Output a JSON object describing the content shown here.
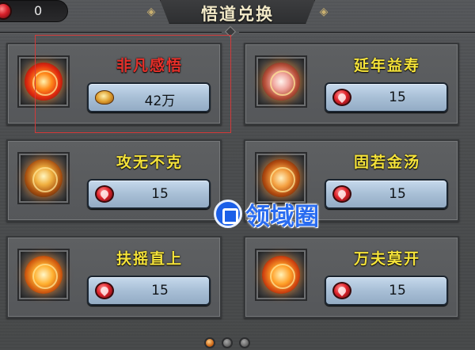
{
  "header": {
    "currency_value": "0",
    "title": "悟道兑换"
  },
  "items": [
    {
      "name": "非凡感悟",
      "name_color": "red",
      "price": "42万",
      "currency": "gold-ingot",
      "orb": "red-fire-triangle",
      "selected": true
    },
    {
      "name": "延年益寿",
      "name_color": "yellow",
      "price": "15",
      "currency": "red-gem",
      "orb": "pink-star"
    },
    {
      "name": "攻无不克",
      "name_color": "yellow",
      "price": "15",
      "currency": "red-gem",
      "orb": "gold-pyramid"
    },
    {
      "name": "固若金汤",
      "name_color": "yellow",
      "price": "15",
      "currency": "red-gem",
      "orb": "orange-hexagram"
    },
    {
      "name": "扶摇直上",
      "name_color": "yellow",
      "price": "15",
      "currency": "red-gem",
      "orb": "orange-vortex"
    },
    {
      "name": "万夫莫开",
      "name_color": "yellow",
      "price": "15",
      "currency": "red-gem",
      "orb": "fire-swirl"
    }
  ],
  "watermark": {
    "text": "领域圈"
  },
  "pager": {
    "pages": 3,
    "current": 1
  },
  "colors": {
    "selection_border": "#d23a3a",
    "name_red": "#e8302a",
    "name_yellow": "#f5e33a",
    "price_bg": "#a8bfd6",
    "watermark_blue": "#2a6cf0"
  }
}
